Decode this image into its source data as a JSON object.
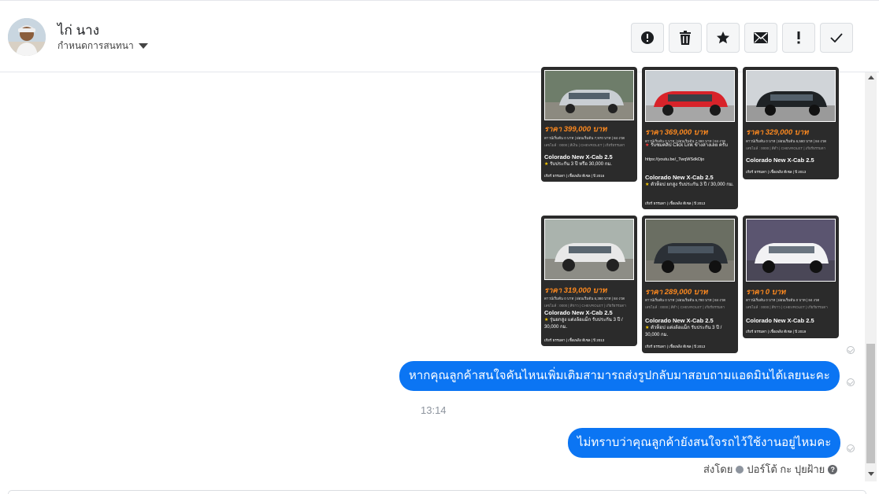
{
  "header": {
    "contact_name": "ไก่ นาง",
    "assign_label": "กำหนดการสนทนา",
    "actions": [
      {
        "name": "report-spam",
        "icon": "alert-circle-icon"
      },
      {
        "name": "delete",
        "icon": "trash-icon"
      },
      {
        "name": "star",
        "icon": "star-icon"
      },
      {
        "name": "mark-unread",
        "icon": "envelope-icon"
      },
      {
        "name": "important",
        "icon": "exclamation-icon"
      },
      {
        "name": "done",
        "icon": "check-icon"
      }
    ]
  },
  "cards": [
    {
      "price": "ราคา 399,000 บาท",
      "specs": "ดาวน์เริ่มต้น 0 บาท | ผ่อนเริ่มต้น 7,970 บาท | 84 งวด",
      "meta": "เลขไมล์ : 0000 | สีเงิน | CHEVROLET | เกียร์ธรรมดา",
      "model": "Colorado New X-Cab 2.5",
      "desc": "รับประกัน 3 ปี หรือ 30,000 กม.",
      "footer": "เกียร์ ธรรมดา | เชื้อเพลิง ดีเซล | ปี 2016"
    },
    {
      "price": "ราคา 369,000 บาท",
      "specs": "ดาวน์เริ่มต้น 0 บาท | ผ่อนเริ่มต้น 7,380 บาท | 84 งวด",
      "meta": "เลขไมล์ : 0000 | สีแดง | CHEVROLET | เกียร์ธรรมดา",
      "model": "Colorado New X-Cab 2.5",
      "desc": "ตัวท็อป ยกสูง รับประกัน 3 ปี / 30,000 กม.",
      "extra": "รับชมคลิป Click Link ข้างล่างเลย ครับ",
      "link": "https://youtu.be/_TwqWSdkDjo",
      "footer": "เกียร์ ธรรมดา | เชื้อเพลิง ดีเซล | ปี 2013"
    },
    {
      "price": "ราคา 329,000 บาท",
      "specs": "ดาวน์เริ่มต้น 0 บาท | ผ่อนเริ่มต้น 6,580 บาท | 84 งวด",
      "meta": "เลขไมล์ : 0000 | สีดำ | CHEVROLET | เกียร์ธรรมดา",
      "model": "Colorado New X-Cab 2.5",
      "desc": "",
      "footer": "เกียร์ ธรรมดา | เชื้อเพลิง ดีเซล | ปี 2013"
    },
    {
      "price": "ราคา 319,000 บาท",
      "specs": "ดาวน์เริ่มต้น 0 บาท | ผ่อนเริ่มต้น 6,380 บาท | 84 งวด",
      "meta": "เลขไมล์ : 0000 | สีขาว | CHEVROLET | เกียร์ธรรมดา",
      "model": "Colorado New X-Cab 2.5",
      "desc": "รุ่นยกสูง แต่งล้อแม็ก รับประกัน 3 ปี / 30,000 กม.",
      "footer": "เกียร์ ธรรมดา | เชื้อเพลิง ดีเซล | ปี 2013"
    },
    {
      "price": "ราคา 289,000 บาท",
      "specs": "ดาวน์เริ่มต้น 0 บาท | ผ่อนเริ่มต้น 5,780 บาท | 84 งวด",
      "meta": "เลขไมล์ : 0000 | สีดำ | CHEVROLET | เกียร์ธรรมดา",
      "model": "Colorado New X-Cab 2.5",
      "desc": "ตัวท็อป แต่งล้อแม็ก รับประกัน 3 ปี / 30,000 กม.",
      "footer": "เกียร์ ธรรมดา | เชื้อเพลิง ดีเซล | ปี 2013"
    },
    {
      "price": "ราคา 0 บาท",
      "specs": "ดาวน์เริ่มต้น 0 บาท | ผ่อนเริ่มต้น 0 บาท | 84 งวด",
      "meta": "เลขไมล์ : 0000 | สีขาว | CHEVROLET | เกียร์ธรรมดา",
      "model": "Colorado New X-Cab 2.5",
      "desc": "",
      "footer": "เกียร์ ธรรมดา | เชื้อเพลิง ดีเซล | ปี 2019"
    }
  ],
  "messages": [
    {
      "text": "หากคุณลูกค้าสนใจคันไหนเพิ่มเติมสามารถส่งรูปกลับมาสอบถามแอดมินได้เลยนะคะ"
    },
    {
      "text": "ไม่ทราบว่าคุณลูกค้ายังสนใจรถไว้ใช้งานอยู่ไหมคะ"
    }
  ],
  "timestamp": "13:14",
  "sent_by": {
    "prefix": "ส่งโดย",
    "name": "ปอร์โต้ กะ ปุยฝ้าย"
  },
  "colors": {
    "bubble": "#0b75f3",
    "price": "#ff8a1f",
    "card_bg": "#2b2b2b"
  }
}
